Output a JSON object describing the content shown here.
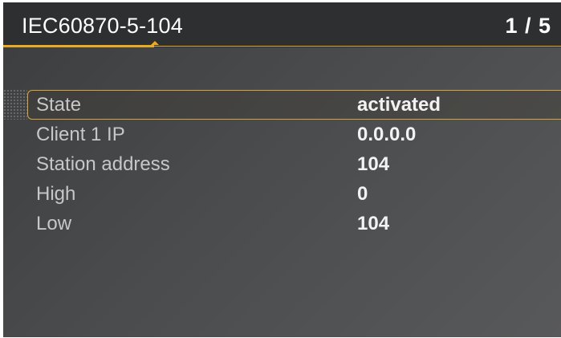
{
  "header": {
    "title": "IEC60870-5-104",
    "page_indicator": "1 / 5"
  },
  "settings": {
    "selected_index": 0,
    "rows": [
      {
        "label": "State",
        "value": "activated"
      },
      {
        "label": "Client 1 IP",
        "value": "0.0.0.0"
      },
      {
        "label": "Station address",
        "value": "104"
      },
      {
        "label": "High",
        "value": "0"
      },
      {
        "label": "Low",
        "value": "104"
      }
    ]
  },
  "colors": {
    "accent": "#e9aa24",
    "header_bg": "#2e2f31",
    "label_text": "#c6c7c8",
    "value_text": "#f2f2f2"
  },
  "progress": {
    "current_page": 1,
    "total_pages": 5
  }
}
